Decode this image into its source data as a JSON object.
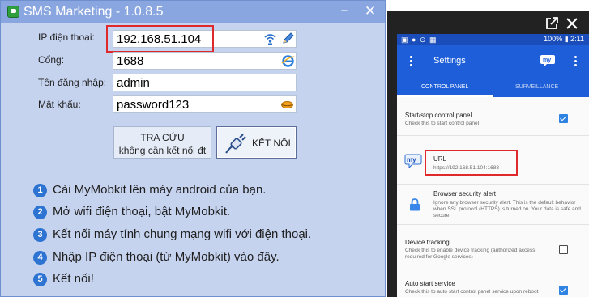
{
  "window": {
    "title": "SMS Marketing - 1.0.8.5",
    "minimize_glyph": "−",
    "close_glyph": "✕"
  },
  "form": {
    "ip": {
      "label": "IP điện thoại:",
      "value": "192.168.51.104"
    },
    "port": {
      "label": "Cổng:",
      "value": "1688"
    },
    "username": {
      "label": "Tên đăng nhập:",
      "value": "admin"
    },
    "password": {
      "label": "Mật khẩu:",
      "value": "password123"
    }
  },
  "buttons": {
    "lookup_line1": "TRA CỨU",
    "lookup_line2": "không cần kết nối đt",
    "connect": "KẾT NỐI"
  },
  "steps": [
    {
      "num": "1",
      "text": "Cài MyMobkit lên máy android của bạn."
    },
    {
      "num": "2",
      "text": "Mở wifi điện thoại, bật MyMobkit."
    },
    {
      "num": "3",
      "text": "Kết nối máy tính chung mạng wifi với điện thoại."
    },
    {
      "num": "4",
      "text": "Nhập IP điện thoại (từ MyMobkit) vào đây."
    },
    {
      "num": "5",
      "text": "Kết nối!"
    }
  ],
  "phone": {
    "status": {
      "left": "▣ ● ⊙ ▦ ···",
      "right": "100% ▮ 2:11"
    },
    "app_title": "Settings",
    "tabs": {
      "control": "CONTROL PANEL",
      "surveillance": "SURVEILLANCE"
    },
    "settings": [
      {
        "title": "Start/stop control panel",
        "desc": "Check this to start control panel",
        "checked": true
      },
      {
        "title": "URL",
        "desc": "https://192.168.51.104:1688"
      },
      {
        "title": "Browser security alert",
        "desc": "Ignore any browser security alert. This is the default behavior when SSL protocol (HTTPS) is turned on. Your data is safe and secure."
      },
      {
        "title": "Device tracking",
        "desc": "Check this to enable device tracking (authorized access required for Google services)",
        "checked": false
      },
      {
        "title": "Auto start service",
        "desc": "Check this to auto start control panel service upon reboot",
        "checked": true
      }
    ],
    "logo_text": "my"
  },
  "colors": {
    "window_bg": "#c6d3ef",
    "titlebar": "#8aa6e0",
    "highlight": "#e0292b",
    "phone_appbar": "#1e5fd9",
    "step_badge": "#2c73d2"
  }
}
